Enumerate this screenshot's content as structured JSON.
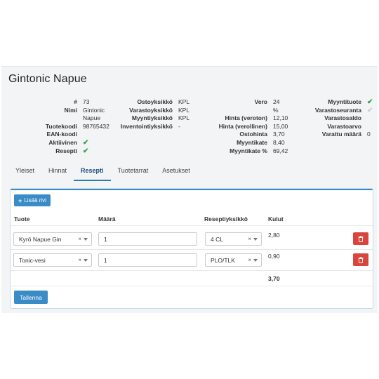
{
  "product": {
    "title": "Gintonic Napue",
    "col1": [
      {
        "label": "#",
        "value": "73"
      },
      {
        "label": "Nimi",
        "value": "Gintonic"
      },
      {
        "label": "",
        "value": "Napue"
      },
      {
        "label": "Tuotekoodi",
        "value": "98765432"
      },
      {
        "label": "EAN-koodi",
        "value": ""
      },
      {
        "label": "Aktiivinen",
        "value": "✔"
      },
      {
        "label": "Resepti",
        "value": "✔"
      }
    ],
    "col2": [
      {
        "label": "Ostoyksikkö",
        "value": "KPL"
      },
      {
        "label": "Varastoyksikkö",
        "value": "KPL"
      },
      {
        "label": "Myyntiyksikkö",
        "value": "KPL"
      },
      {
        "label": "Inventointiyksikkö",
        "value": "-"
      }
    ],
    "col3": [
      {
        "label": "Vero",
        "value": "24"
      },
      {
        "label": "",
        "value": "%"
      },
      {
        "label": "Hinta (veroton)",
        "value": "12,10"
      },
      {
        "label": "Hinta (verollinen)",
        "value": "15,00"
      },
      {
        "label": "Ostohinta",
        "value": "3,70"
      },
      {
        "label": "Myyntikate",
        "value": "8,40"
      },
      {
        "label": "Myyntikate %",
        "value": "69,42"
      }
    ],
    "col4": [
      {
        "label": "Myyntituote",
        "value": "✔"
      },
      {
        "label": "Varastoseuranta",
        "value": "✔"
      },
      {
        "label": "Varastosaldo",
        "value": ""
      },
      {
        "label": "Varastoarvo",
        "value": ""
      },
      {
        "label": "Varattu määrä",
        "value": "0"
      }
    ]
  },
  "tabs": [
    "Yleiset",
    "Hinnat",
    "Resepti",
    "Tuotetarrat",
    "Asetukset"
  ],
  "active_tab": "Resepti",
  "recipe": {
    "add_row_label": "Lisää rivi",
    "headers": {
      "product": "Tuote",
      "amount": "Määrä",
      "unit": "Reseptiyksikkö",
      "cost": "Kulut"
    },
    "rows": [
      {
        "product": "Kyrö Napue Gin",
        "amount": "1",
        "unit": "4 CL",
        "cost": "2,80"
      },
      {
        "product": "Tonic-vesi",
        "amount": "1",
        "unit": "PLO/TLK",
        "cost": "0,90"
      }
    ],
    "total": "3,70",
    "save_label": "Tallenna"
  },
  "colors": {
    "accent": "#3a8cc6",
    "danger": "#d9443c",
    "success": "#2ea44f"
  },
  "icons": {
    "check": "check-icon",
    "trash": "trash-icon",
    "plus": "plus-icon",
    "clear": "clear-icon",
    "caret": "chevron-down-icon"
  }
}
